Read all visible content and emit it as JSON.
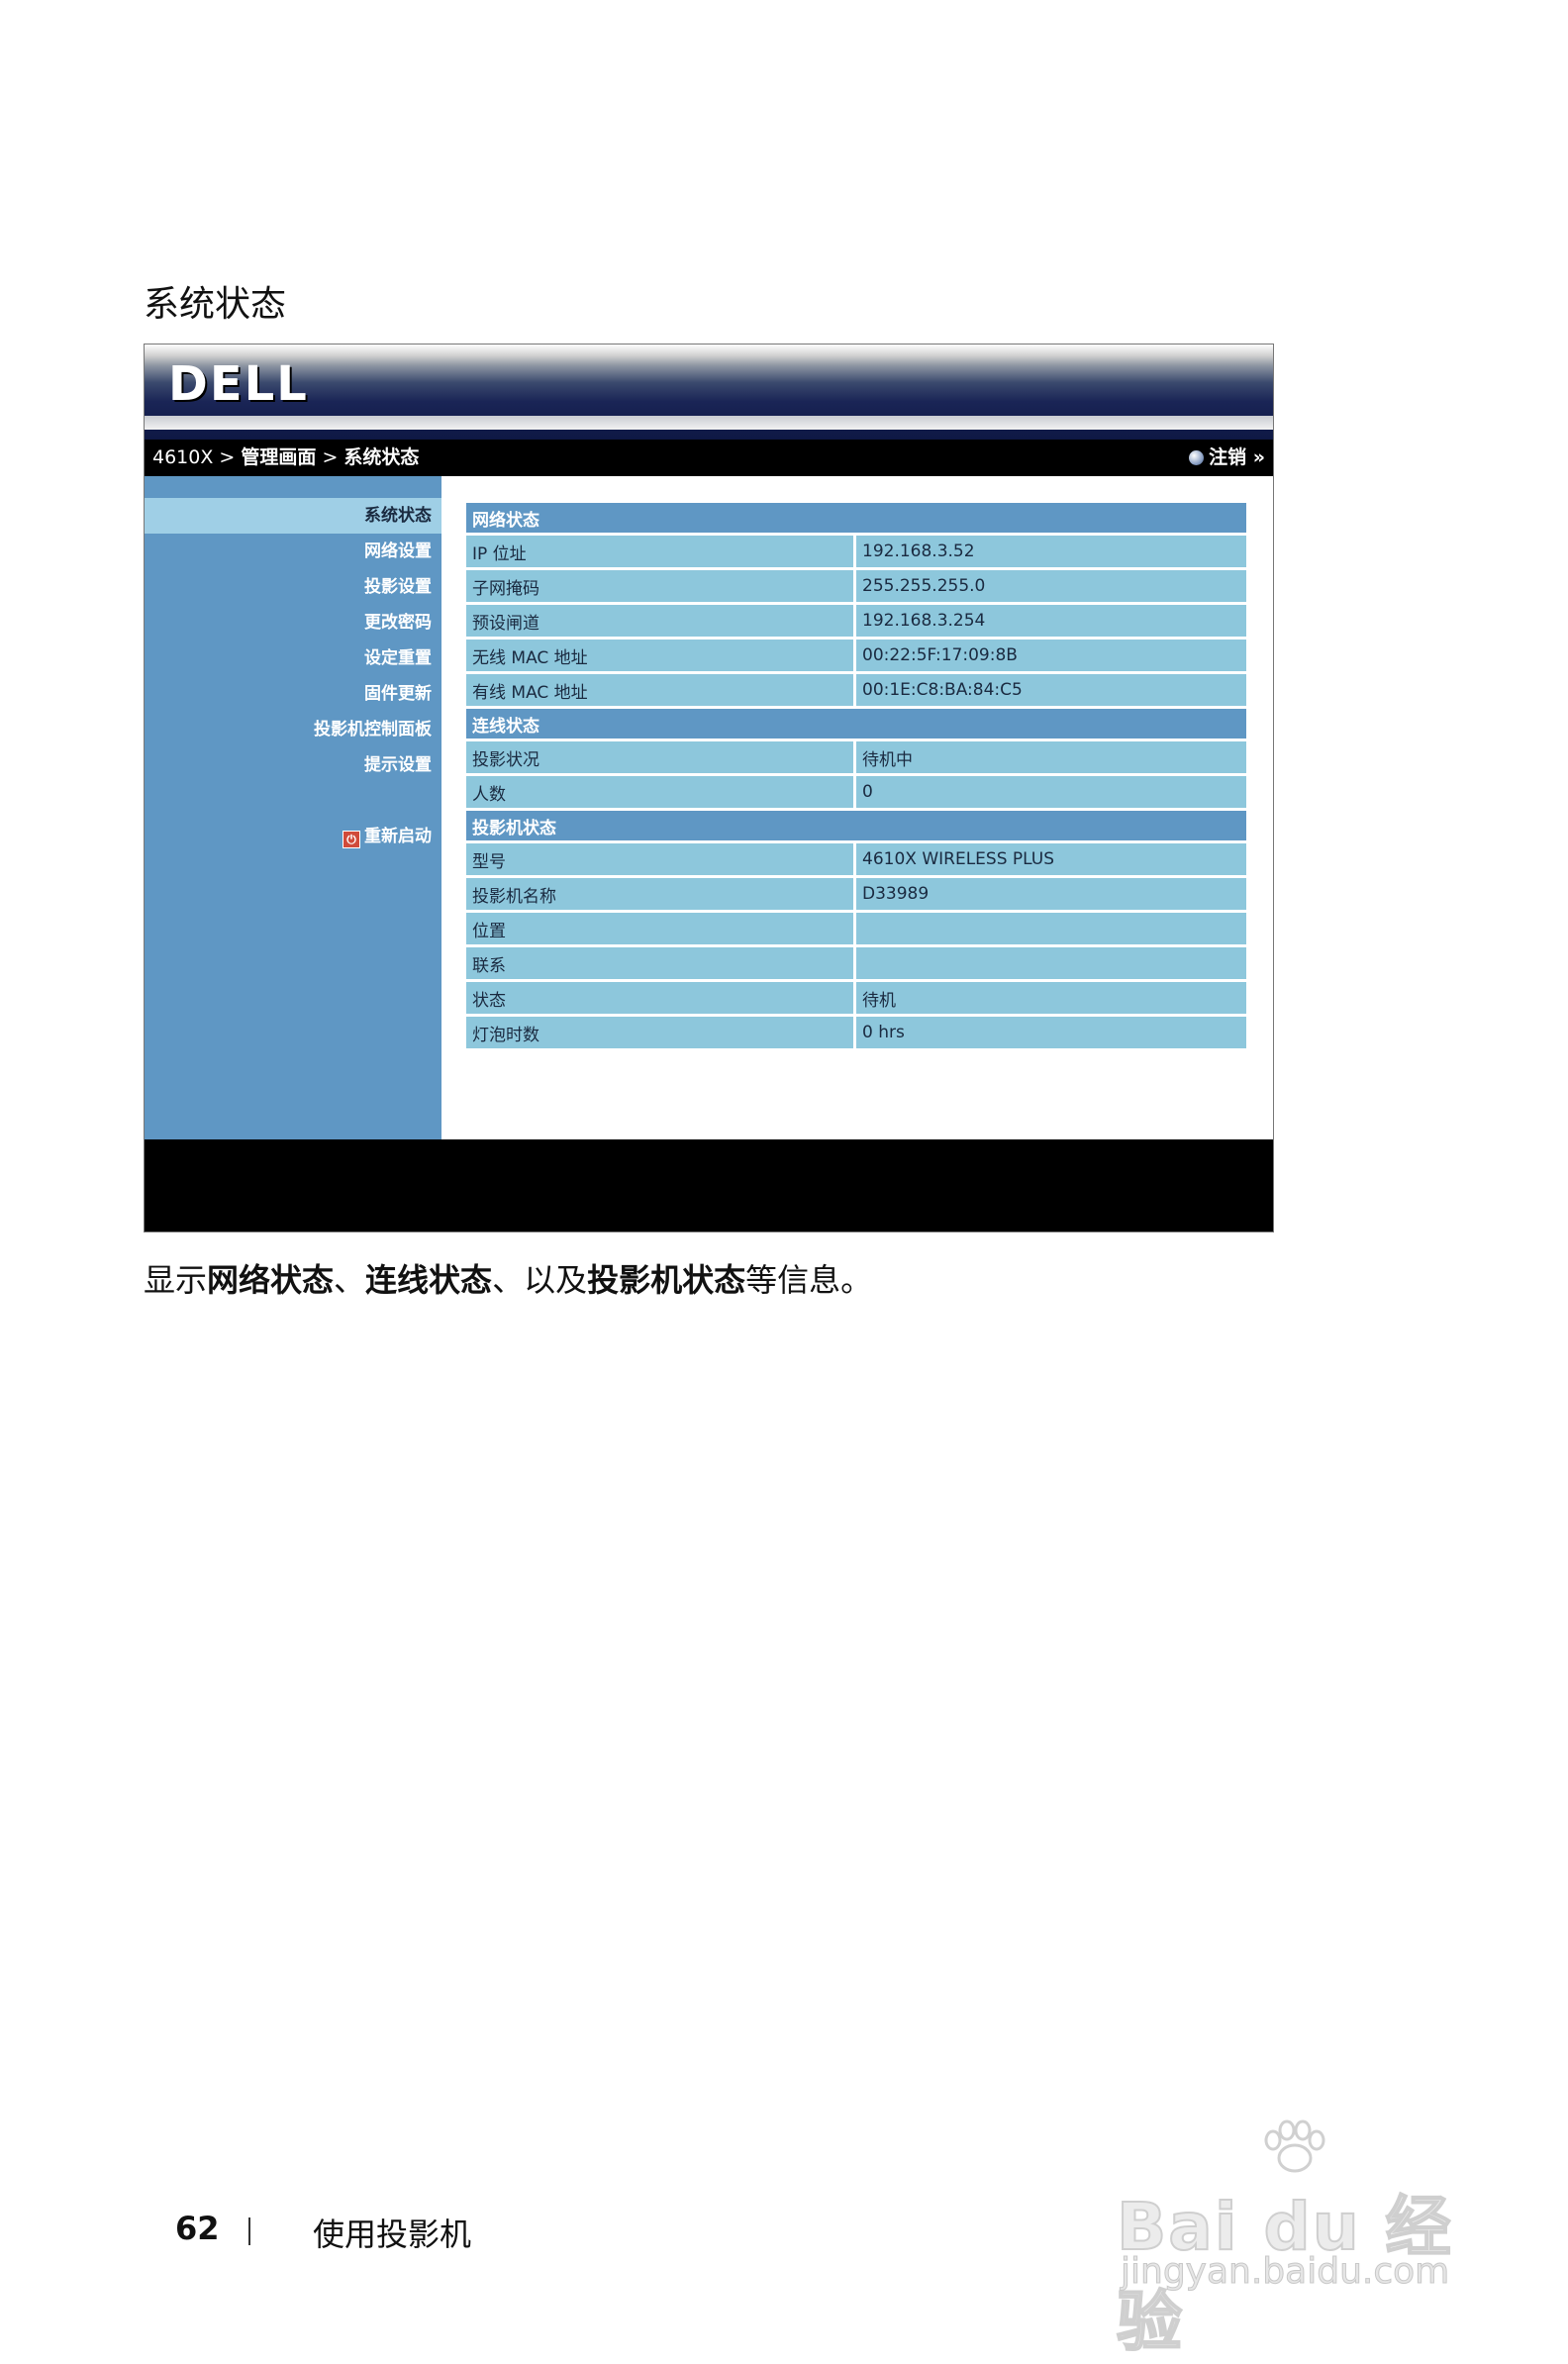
{
  "page": {
    "heading": "系统状态",
    "caption_parts": [
      {
        "text": "显示",
        "bold": false
      },
      {
        "text": "网络状态",
        "bold": true
      },
      {
        "text": "、",
        "bold": false
      },
      {
        "text": "连线状态",
        "bold": true
      },
      {
        "text": "、以及",
        "bold": false
      },
      {
        "text": "投影机状态",
        "bold": true
      },
      {
        "text": "等信息。",
        "bold": false
      }
    ],
    "footer": {
      "page_number": "62",
      "section": "使用投影机"
    },
    "watermark": {
      "main": "Bai du 经验",
      "url": "jingyan.baidu.com"
    }
  },
  "ui": {
    "logo": "DELL",
    "breadcrumb": {
      "model": "4610X",
      "sep": ">",
      "admin": "管理画面",
      "current": "系统状态"
    },
    "logout_label": "注销 »",
    "sidebar": [
      {
        "label": "系统状态",
        "active": true
      },
      {
        "label": "网络设置",
        "active": false
      },
      {
        "label": "投影设置",
        "active": false
      },
      {
        "label": "更改密码",
        "active": false
      },
      {
        "label": "设定重置",
        "active": false
      },
      {
        "label": "固件更新",
        "active": false
      },
      {
        "label": "投影机控制面板",
        "active": false
      },
      {
        "label": "提示设置",
        "active": false
      }
    ],
    "restart_label": "重新启动",
    "sections": [
      {
        "title": "网络状态",
        "rows": [
          {
            "k": "IP 位址",
            "v": "192.168.3.52"
          },
          {
            "k": "子网掩码",
            "v": "255.255.255.0"
          },
          {
            "k": "预设闸道",
            "v": "192.168.3.254"
          },
          {
            "k": "无线 MAC 地址",
            "v": "00:22:5F:17:09:8B"
          },
          {
            "k": "有线 MAC 地址",
            "v": "00:1E:C8:BA:84:C5"
          }
        ]
      },
      {
        "title": "连线状态",
        "rows": [
          {
            "k": "投影状况",
            "v": "待机中"
          },
          {
            "k": "人数",
            "v": "0"
          }
        ]
      },
      {
        "title": "投影机状态",
        "rows": [
          {
            "k": "型号",
            "v": "4610X WIRELESS PLUS"
          },
          {
            "k": "投影机名称",
            "v": "D33989"
          },
          {
            "k": "位置",
            "v": ""
          },
          {
            "k": "联系",
            "v": ""
          },
          {
            "k": "状态",
            "v": "待机"
          },
          {
            "k": "灯泡时数",
            "v": "0 hrs"
          }
        ]
      }
    ]
  }
}
